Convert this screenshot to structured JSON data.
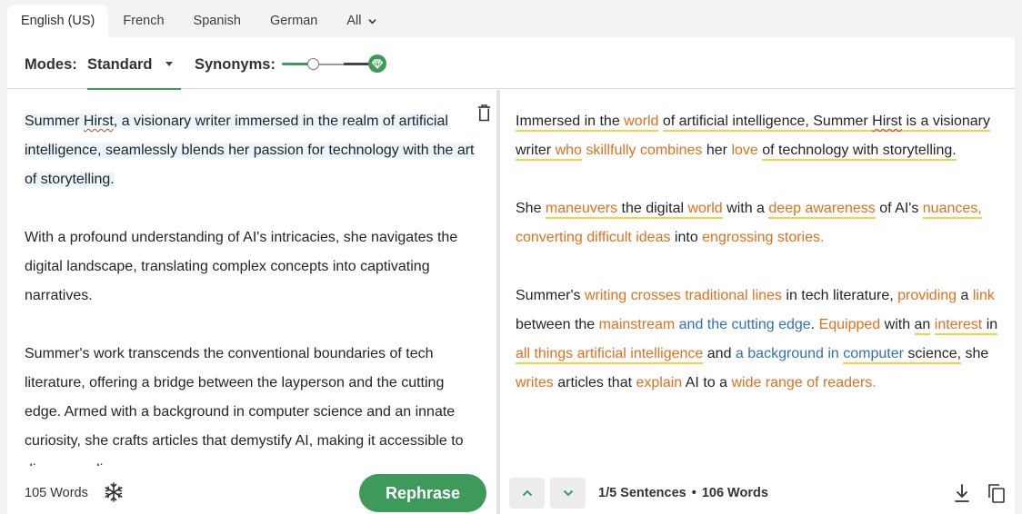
{
  "tabs": [
    {
      "label": "English (US)"
    },
    {
      "label": "French"
    },
    {
      "label": "Spanish"
    },
    {
      "label": "German"
    },
    {
      "label": "All"
    }
  ],
  "active_tab": "English (US)",
  "toolbar": {
    "modes_label": "Modes:",
    "mode_value": "Standard",
    "synonyms_label": "Synonyms:",
    "synonyms_level": 0.3
  },
  "input": {
    "paragraphs": [
      {
        "parts": [
          {
            "text": "Summer "
          },
          {
            "text": "Hirst",
            "squiggle": true
          },
          {
            "text": ", a visionary writer immersed in the realm of artificial intelligence, seamlessly blends her passion for technology with the art of storytelling."
          }
        ]
      },
      {
        "parts": [
          {
            "text": "With a profound understanding of AI's intricacies, she navigates the digital landscape, translating complex concepts into captivating narratives."
          }
        ]
      },
      {
        "parts": [
          {
            "text": "Summer's work transcends the conventional boundaries of tech literature, offering a bridge between the layperson and the cutting edge. Armed with a background in computer science and an innate curiosity, she crafts articles that demystify AI, making it accessible to diverse audiences."
          }
        ]
      }
    ],
    "word_count": "105 Words"
  },
  "output": {
    "paragraphs": [
      {
        "parts": [
          {
            "text": "Immersed in the ",
            "u": true
          },
          {
            "text": "world",
            "c": "o",
            "u": true
          },
          {
            "text": " "
          },
          {
            "text": "of artificial intelligence, Summer ",
            "u": true
          },
          {
            "text": "Hirst",
            "u": true,
            "squiggle": true
          },
          {
            "text": " is a visionary writer ",
            "u": true
          },
          {
            "text": "who",
            "c": "o",
            "u": true
          },
          {
            "text": " "
          },
          {
            "text": "skillfully combines",
            "c": "o"
          },
          {
            "text": " her "
          },
          {
            "text": "love",
            "c": "o"
          },
          {
            "text": " "
          },
          {
            "text": "of technology with storytelling.",
            "u": true
          }
        ]
      },
      {
        "parts": [
          {
            "text": "She "
          },
          {
            "text": "maneuvers",
            "c": "o",
            "u": true
          },
          {
            "text": " the digital ",
            "u": true
          },
          {
            "text": "world",
            "c": "o",
            "u": true
          },
          {
            "text": " with a "
          },
          {
            "text": "deep awareness",
            "c": "o",
            "u": true
          },
          {
            "text": " of AI's "
          },
          {
            "text": "nuances,",
            "c": "o",
            "u": true
          },
          {
            "text": " "
          },
          {
            "text": "converting difficult ideas",
            "c": "o"
          },
          {
            "text": " into "
          },
          {
            "text": "engrossing stories.",
            "c": "o"
          }
        ]
      },
      {
        "parts": [
          {
            "text": "Summer's "
          },
          {
            "text": "writing crosses traditional lines",
            "c": "o"
          },
          {
            "text": " in tech literature, "
          },
          {
            "text": "providing",
            "c": "o"
          },
          {
            "text": " a "
          },
          {
            "text": "link",
            "c": "o"
          },
          {
            "text": " between the "
          },
          {
            "text": "mainstream",
            "c": "o"
          },
          {
            "text": " "
          },
          {
            "text": "and the cutting edge",
            "c": "b"
          },
          {
            "text": ". "
          },
          {
            "text": "Equipped",
            "c": "o"
          },
          {
            "text": " with "
          },
          {
            "text": "an",
            "u": true
          },
          {
            "text": " "
          },
          {
            "text": "interest",
            "c": "o",
            "u": true
          },
          {
            "text": " in ",
            "u": true
          },
          {
            "text": "all things artificial intelligence",
            "c": "o",
            "u": true
          },
          {
            "text": " and "
          },
          {
            "text": "a background in",
            "c": "b"
          },
          {
            "text": " "
          },
          {
            "text": "computer",
            "c": "b",
            "u": true
          },
          {
            "text": " science,",
            "u": true
          },
          {
            "text": " she "
          },
          {
            "text": "writes",
            "c": "o"
          },
          {
            "text": " articles that "
          },
          {
            "text": "explain",
            "c": "o"
          },
          {
            "text": " AI to a "
          },
          {
            "text": "wide range of readers.",
            "c": "o"
          }
        ]
      }
    ],
    "sentence_counter": "1/5 Sentences",
    "separator": "•",
    "word_count": "106 Words"
  },
  "buttons": {
    "rephrase": "Rephrase"
  },
  "colors": {
    "accent": "#3e9a5a",
    "changed_word": "#e0701e",
    "structural_change": "#2f72b8",
    "longest_unchanged": "#f3d24a",
    "input_highlight": "#eaf5fc"
  }
}
